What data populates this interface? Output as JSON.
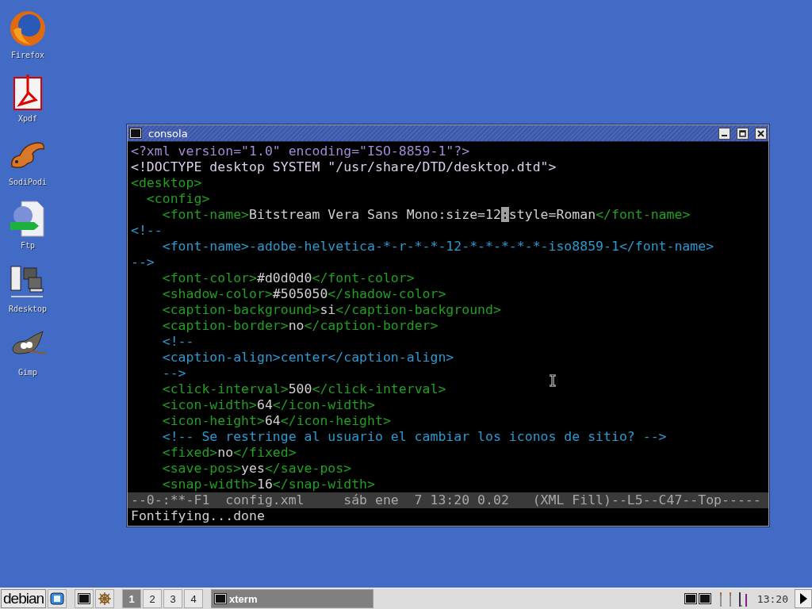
{
  "desktop_icons": [
    {
      "label": "Firefox",
      "kind": "firefox"
    },
    {
      "label": "Xpdf",
      "kind": "pdf"
    },
    {
      "label": "SodiPodi",
      "kind": "lizard"
    },
    {
      "label": "Ftp",
      "kind": "ftp"
    },
    {
      "label": "Rdesktop",
      "kind": "computers"
    },
    {
      "label": "Gimp",
      "kind": "gimp"
    }
  ],
  "window": {
    "title": "consola",
    "lines": [
      [
        {
          "kind": "pi",
          "text": "<?xml version=\"1.0\" encoding=\"ISO-8859-1\"?>"
        }
      ],
      [
        {
          "kind": "doctype",
          "text": "<!DOCTYPE desktop SYSTEM \"/usr/share/DTD/desktop.dtd\">"
        }
      ],
      [
        {
          "kind": "tag",
          "text": "<desktop>"
        }
      ],
      [
        {
          "kind": "tag",
          "text": "  <config>"
        }
      ],
      [
        {
          "kind": "tag",
          "text": "    <font-name>"
        },
        {
          "kind": "text",
          "text": "Bitstream Vera Sans Mono:size=12"
        },
        {
          "kind": "cursor",
          "text": ":"
        },
        {
          "kind": "text",
          "text": "style=Roman"
        },
        {
          "kind": "tag",
          "text": "</font-name>"
        }
      ],
      [
        {
          "kind": "comment",
          "text": "<!--"
        }
      ],
      [
        {
          "kind": "comment",
          "text": "    <font-name>-adobe-helvetica-*-r-*-*-12-*-*-*-*-*-iso8859-1</font-name>"
        }
      ],
      [
        {
          "kind": "comment",
          "text": "-->"
        }
      ],
      [
        {
          "kind": "tag",
          "text": "    <font-color>"
        },
        {
          "kind": "text",
          "text": "#d0d0d0"
        },
        {
          "kind": "tag",
          "text": "</font-color>"
        }
      ],
      [
        {
          "kind": "tag",
          "text": "    <shadow-color>"
        },
        {
          "kind": "text",
          "text": "#505050"
        },
        {
          "kind": "tag",
          "text": "</shadow-color>"
        }
      ],
      [
        {
          "kind": "tag",
          "text": "    <caption-background>"
        },
        {
          "kind": "text",
          "text": "si"
        },
        {
          "kind": "tag",
          "text": "</caption-background>"
        }
      ],
      [
        {
          "kind": "tag",
          "text": "    <caption-border>"
        },
        {
          "kind": "text",
          "text": "no"
        },
        {
          "kind": "tag",
          "text": "</caption-border>"
        }
      ],
      [
        {
          "kind": "comment",
          "text": "    <!--"
        }
      ],
      [
        {
          "kind": "comment",
          "text": "    <caption-align>center</caption-align>"
        }
      ],
      [
        {
          "kind": "comment",
          "text": "    -->"
        }
      ],
      [
        {
          "kind": "tag",
          "text": "    <click-interval>"
        },
        {
          "kind": "text",
          "text": "500"
        },
        {
          "kind": "tag",
          "text": "</click-interval>"
        }
      ],
      [
        {
          "kind": "tag",
          "text": "    <icon-width>"
        },
        {
          "kind": "text",
          "text": "64"
        },
        {
          "kind": "tag",
          "text": "</icon-width>"
        }
      ],
      [
        {
          "kind": "tag",
          "text": "    <icon-height>"
        },
        {
          "kind": "text",
          "text": "64"
        },
        {
          "kind": "tag",
          "text": "</icon-height>"
        }
      ],
      [
        {
          "kind": "comment",
          "text": "    <!-- Se restringe al usuario el cambiar los iconos de sitio? -->"
        }
      ],
      [
        {
          "kind": "tag",
          "text": "    <fixed>"
        },
        {
          "kind": "text",
          "text": "no"
        },
        {
          "kind": "tag",
          "text": "</fixed>"
        }
      ],
      [
        {
          "kind": "tag",
          "text": "    <save-pos>"
        },
        {
          "kind": "text",
          "text": "yes"
        },
        {
          "kind": "tag",
          "text": "</save-pos>"
        }
      ],
      [
        {
          "kind": "tag",
          "text": "    <snap-width>"
        },
        {
          "kind": "text",
          "text": "16"
        },
        {
          "kind": "tag",
          "text": "</snap-width>"
        }
      ]
    ],
    "mode_line": "--0-:**-F1  config.xml     sáb ene  7 13:20 0.02   (XML Fill)--L5--C47--Top-----",
    "minibuffer": "Fontifying...done"
  },
  "taskbar": {
    "start_label": "debian",
    "workspaces": [
      {
        "label": "1",
        "selected": true
      },
      {
        "label": "2",
        "selected": false
      },
      {
        "label": "3",
        "selected": false
      },
      {
        "label": "4",
        "selected": false
      }
    ],
    "tasks": [
      {
        "label": "xterm",
        "selected": true
      }
    ],
    "clock": "13:20"
  }
}
